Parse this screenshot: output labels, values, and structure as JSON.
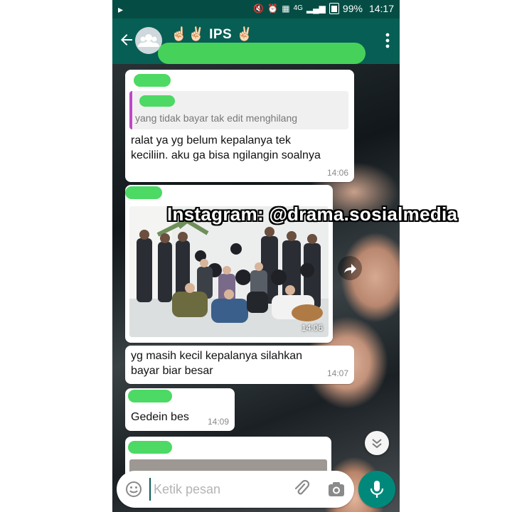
{
  "status_bar": {
    "battery": "99%",
    "time": "14:17",
    "network": "4G"
  },
  "toolbar": {
    "group_name": "IPS",
    "title_prefix_emoji": "☝🏻✌🏻",
    "title_suffix_emoji": "✌🏻"
  },
  "messages": [
    {
      "quoted_text": "yang tidak bayar tak edit menghilang",
      "text_line1": "ralat ya yg belum kepalanya tek",
      "text_line2": "keciliin. aku ga bisa ngilangin soalnya",
      "time": "14:06"
    },
    {
      "image_time": "14:06"
    },
    {
      "text_line1": "yg masih kecil kepalanya silahkan",
      "text_line2": "bayar biar besar",
      "time": "14:07"
    },
    {
      "text": "Gedein bes",
      "time": "14:09"
    }
  ],
  "watermark": "Instagram: @drama.sosialmedia",
  "composer": {
    "placeholder": "Ketik pesan"
  },
  "colors": {
    "header": "#075e54",
    "status_bar": "#054d44",
    "mic_button": "#00897b",
    "quote_bar": "#c046c8",
    "redaction": "#4cd964"
  },
  "icons": [
    "back-arrow-icon",
    "group-avatar-icon",
    "menu-icon",
    "forward-icon",
    "scroll-down-icon",
    "emoji-icon",
    "attach-icon",
    "camera-icon",
    "mic-icon"
  ]
}
